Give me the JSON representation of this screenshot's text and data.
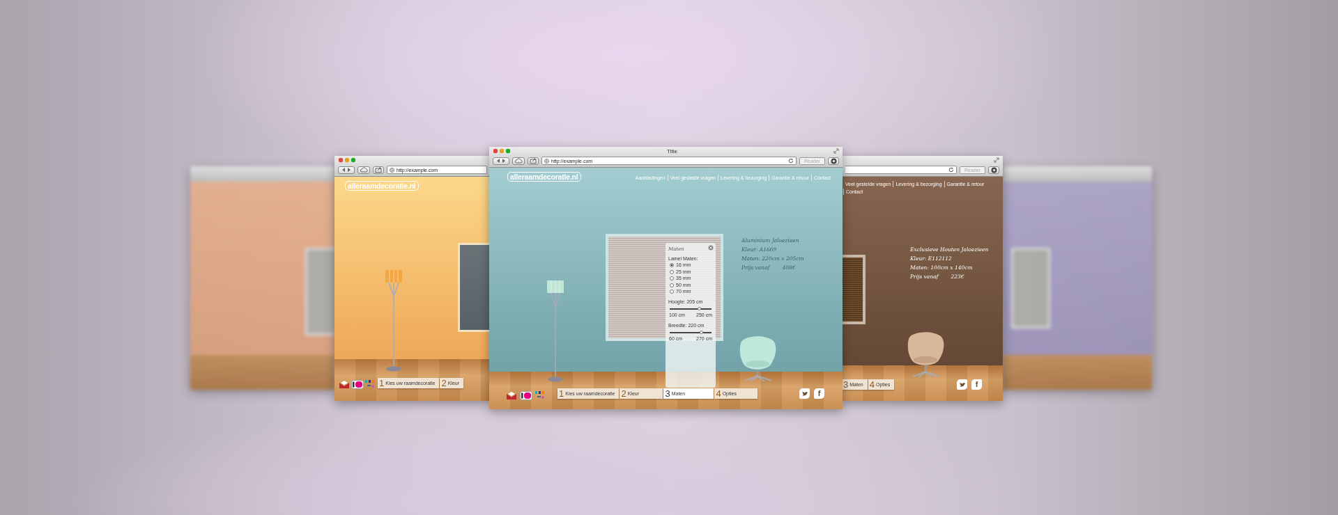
{
  "windows": [
    {
      "kind": "blurred"
    },
    {
      "kind": "left",
      "url": "http://example.com",
      "logo": "alleraamdecoratie.nl",
      "steps": [
        {
          "number": "1",
          "label": "Kies uw raamdecoratie",
          "selected": false
        },
        {
          "number": "2",
          "label": "Kleur",
          "selected": false
        }
      ]
    },
    {
      "kind": "blurred"
    },
    {
      "kind": "right",
      "reader": "Reader",
      "nav": [
        "Veel gestelde vragen",
        "Levering & bezorging",
        "Garantie & retour",
        "Contact"
      ],
      "product": [
        "Exclusieve Houten Jaloezieen",
        "Kleur: E112112",
        "Maten: 100cm x 140cm"
      ],
      "price": {
        "label": "Prijs vanaf",
        "value": "223€"
      },
      "steps": [
        {
          "number": "3",
          "label": "Maten",
          "selected": false
        },
        {
          "number": "4",
          "label": "Opties",
          "selected": false
        }
      ],
      "social": [
        {
          "kind": "bird"
        },
        {
          "kind": "letter",
          "text": "f"
        }
      ]
    },
    {
      "kind": "main",
      "title": "Title",
      "url": "http://example.com",
      "reader": "Reader",
      "logo": "alleraamdecoratie.nl",
      "nav": [
        "Aanbiedingen",
        "Veel gestelde vragen",
        "Levering & bezorging",
        "Garantie & retour",
        "Contact"
      ],
      "product": [
        "Aluminium Jaloezieen",
        "Kleur: A1669",
        "Maten: 220cm x 205cm"
      ],
      "price": {
        "label": "Prijs vanaf",
        "value": "408€"
      },
      "popup": {
        "title": "Maten",
        "group_label": "Lamel Maten:",
        "options": [
          {
            "label": "16 mm",
            "selected": true
          },
          {
            "label": "25 mm",
            "selected": false
          },
          {
            "label": "35 mm",
            "selected": false
          },
          {
            "label": "50 mm",
            "selected": false
          },
          {
            "label": "70 mm",
            "selected": false
          }
        ],
        "sliders": [
          {
            "label": "Hoogte: 205 cm",
            "level": 0.7,
            "min": "100 cm",
            "max": "250 cm"
          },
          {
            "label": "Breedte: 220 cm",
            "level": 0.76,
            "min": "60 cm",
            "max": "270 cm"
          }
        ]
      },
      "steps": [
        {
          "number": "1",
          "label": "Kies uw raamdecoratie",
          "selected": false
        },
        {
          "number": "2",
          "label": "Kleur",
          "selected": false
        },
        {
          "number": "3",
          "label": "Maten",
          "selected": true
        },
        {
          "number": "4",
          "label": "Opties",
          "selected": false
        }
      ],
      "social": [
        {
          "kind": "bird"
        },
        {
          "kind": "letter",
          "text": "f"
        }
      ]
    }
  ]
}
